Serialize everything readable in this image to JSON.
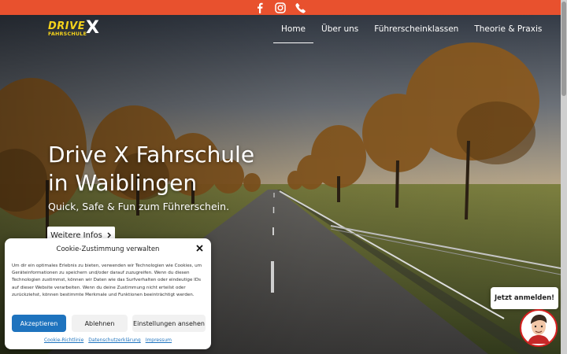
{
  "topbar": {
    "background": "#e8512e",
    "icons": [
      "facebook-icon",
      "instagram-icon",
      "phone-icon"
    ]
  },
  "logo": {
    "word_top": "DRIVE",
    "word_bottom": "FAHRSCHULE",
    "mark": "X",
    "color": "#f4d21b"
  },
  "nav": {
    "items": [
      {
        "label": "Home",
        "active": true
      },
      {
        "label": "Über uns",
        "active": false
      },
      {
        "label": "Führerscheinklassen",
        "active": false
      },
      {
        "label": "Theorie & Praxis",
        "active": false
      }
    ]
  },
  "hero": {
    "title_line1": "Drive X Fahrschule",
    "title_line2": "in Waiblingen",
    "subtitle": "Quick, Safe & Fun zum Führerschein.",
    "button_label": "Weitere Infos",
    "button_icon": "chevron-right-icon"
  },
  "cookie": {
    "title": "Cookie-Zustimmung verwalten",
    "close_icon": "close-icon",
    "text": "Um dir ein optimales Erlebnis zu bieten, verwenden wir Technologien wie Cookies, um Geräteinformationen zu speichern und/oder darauf zuzugreifen. Wenn du diesen Technologien zustimmst, können wir Daten wie das Surfverhalten oder eindeutige IDs auf dieser Website verarbeiten. Wenn du deine Zustimmung nicht erteilst oder zurückziehst, können bestimmte Merkmale und Funktionen beeinträchtigt werden.",
    "accept_label": "Akzeptieren",
    "deny_label": "Ablehnen",
    "settings_label": "Einstellungen ansehen",
    "links": [
      "Cookie-Richtlinie",
      "Datenschutzerklärung",
      "Impressum"
    ],
    "accent": "#1e73be"
  },
  "cta": {
    "label": "Jetzt anmelden!",
    "avatar_icon": "instructor-avatar-icon"
  }
}
